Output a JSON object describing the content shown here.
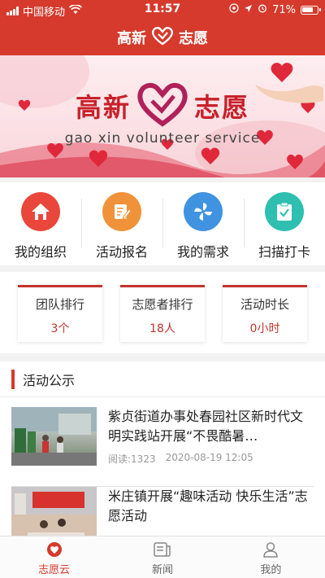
{
  "status_bar": {
    "carrier": "中国移动",
    "time": "11:57",
    "battery_percent": "71%"
  },
  "header": {
    "title_left": "高新",
    "title_right": "志愿"
  },
  "banner": {
    "title_left": "高新",
    "title_right": "志愿",
    "subtitle": "gao xin volunteer service"
  },
  "quick_menu": [
    {
      "label": "我的组织",
      "icon": "organization-icon",
      "color": "#e9473c"
    },
    {
      "label": "活动报名",
      "icon": "signup-edit-icon",
      "color": "#f0923a"
    },
    {
      "label": "我的需求",
      "icon": "pinwheel-icon",
      "color": "#3f93e0"
    },
    {
      "label": "扫描打卡",
      "icon": "clipboard-check-icon",
      "color": "#2fbfb0"
    }
  ],
  "rankings": [
    {
      "title": "团队排行",
      "value": "3个"
    },
    {
      "title": "志愿者排行",
      "value": "18人"
    },
    {
      "title": "活动时长",
      "value": "0小时"
    }
  ],
  "section": {
    "title": "活动公示"
  },
  "news": [
    {
      "title": "紫贞街道办事处春园社区新时代文明实践站开展“不畏酷暑…",
      "reads": "阅读:1323",
      "date": "2020-08-19 12:05"
    },
    {
      "title": "米庄镇开展“趣味活动 快乐生活”志愿活动",
      "reads": "",
      "date": ""
    }
  ],
  "tabbar": [
    {
      "label": "志愿云",
      "icon": "heart-cloud-icon",
      "active": true
    },
    {
      "label": "新闻",
      "icon": "news-icon",
      "active": false
    },
    {
      "label": "我的",
      "icon": "user-icon",
      "active": false
    }
  ],
  "colors": {
    "brand_red": "#d53a2c",
    "rank_accent": "#c4352b"
  }
}
